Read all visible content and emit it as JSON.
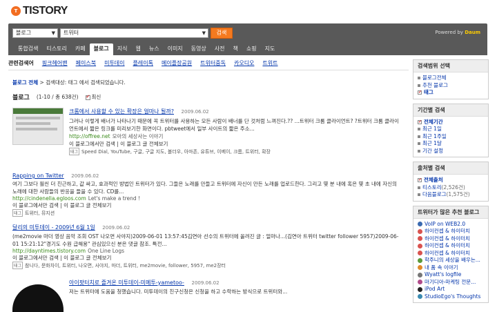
{
  "logo": {
    "icon": "T",
    "text": "TISTORY"
  },
  "search": {
    "scope": "블로그",
    "query": "트위터",
    "button": "검색",
    "powered": "Powered by",
    "brand": "Daum"
  },
  "tabs": [
    "통합검색",
    "티스토리",
    "카페",
    "블로그",
    "지식",
    "웹",
    "뉴스",
    "이미지",
    "동영상",
    "사전",
    "책",
    "쇼핑",
    "지도"
  ],
  "related": {
    "label": "관련검색어",
    "terms": [
      "핑크헤어밴",
      "페이스북",
      "미투데이",
      "플레이톡",
      "메이플장공원",
      "트위터중독",
      "카오디오",
      "트위트"
    ]
  },
  "breadcrumb": {
    "root": "블로그 전체",
    "sep": " > ",
    "text": "검색대상: 태그 에서 검색되었습니다."
  },
  "count": {
    "title": "블로그",
    "range": "(1-10 / 총 638건)",
    "recent": "최신"
  },
  "results": [
    {
      "title": "크롬에서 사용할 수 있는 확장은 얼마나 될까?",
      "date": "2009.06.02",
      "body": "그러나 이렇게 배너가 나타나기 때문에 꼭 트위터를 사용하는 모든 사람이 배너를 단 것처럼 느껴진다.?? ...트위터 크롬 클라이언트? ?트위터 크롬 클라이언트에서 짧은 링크를 미리보기한 화면이다. pbtweet에서 일부 사이트의 짧은 주소...",
      "url": "http://offree.net",
      "url_note": "모아의 세상사는 이야기",
      "links": "이 블로그에서만 검색   |   이 블로그 글 전체보기",
      "tags": "Speed Dial, YouTube, 구글, 구글 지도, 볼더우, 아마존, 유튜브, 이베이, 크롬, 트위터, 확장"
    },
    {
      "title": "Rapping on Twitter",
      "date": "2009.06.02",
      "body": "여기 그보다 훨씬 더 친근하고, 값 싸고, 효과적인 방법인 트위터가 있다. 그들은 노래를 만들고 트위터에 자신이 만든 노래를 업로드한다. 그리고 몇 분 내에 혹은 몇 초 내에 자신의 노래에 대한 사람들의 반응을 들을 수 있다. CD를...",
      "url": "http://cindenella.egloos.com",
      "url_note": "Let's make a trend !",
      "links": "이 블로그에서만 검색   |   이 블로그 글 전체보기",
      "tags": "트위터, 뮤지션"
    },
    {
      "title": "달리의 미투데이 - 2009년 6월 1일",
      "date": "2009.06.02",
      "body": "(me2movie 마더 영상 음악 조회 OST 나오면 사야지)2009-06-01 13:57:45김연아 선수의 트위터에 올려진 글 : 얼마나...(김연아 트위터 twitter follower 5957)2009-06-01 15:21:12\"경기도 수원 급해용\" 관심있으신 분은 댓글 참조. 특전...",
      "url": "http://dayntimes.tistory.com",
      "url_note": "One Line Logs",
      "links": "이 블로그에서만 검색   |   이 블로그 글 전체보기",
      "tags": "참니다, 문화차이, 트위터, 나오면, 사야지, 마더, 트위터, me2movie, follower, 5957, me2장터"
    },
    {
      "title": "아이팟터치로 즐겨온 미투데이-미메투-yametoo-",
      "date": "2009.06.02",
      "body": "저는 트위터에 도움을 청했습니다. 미투데이의 친구신청은 신청을 하고 수락하는 방식으로 트위터와..."
    }
  ],
  "sidebar": {
    "section1": {
      "title": "검색범위 선택",
      "items": [
        "블로그전체",
        "추천 블로그",
        "태그"
      ]
    },
    "section2": {
      "title": "기간별 검색",
      "items": [
        "전체기간",
        "최근 1일",
        "최근 1주일",
        "최근 1달",
        "기간 설정"
      ]
    },
    "section3": {
      "title": "출처별 검색",
      "items": [
        {
          "label": "전체출처",
          "count": ""
        },
        {
          "label": "티스토리",
          "count": "(2,526건)"
        },
        {
          "label": "다음블로그",
          "count": "(1,575건)"
        }
      ]
    },
    "section4": {
      "title": "트위터가 많은 추천 블로그",
      "items": [
        "VoIP on WEB2.0",
        "하이컨셉 & 하이터치",
        "하이컨셉 & 하이터치",
        "하이컨셉 & 하이터치",
        "하이컨셉 & 하이터치",
        "학주니의 세상을 배우는...",
        "내 품 속 이야기",
        "Wyatt's logfile",
        "마기디아-마케팅 전문...",
        "iPod Art",
        "StudioEgo's Thoughts"
      ]
    }
  },
  "colors": {
    "accent": "#f57a1f",
    "searchbar": "#595959",
    "link": "#0033aa",
    "url": "#3a8a1a"
  }
}
